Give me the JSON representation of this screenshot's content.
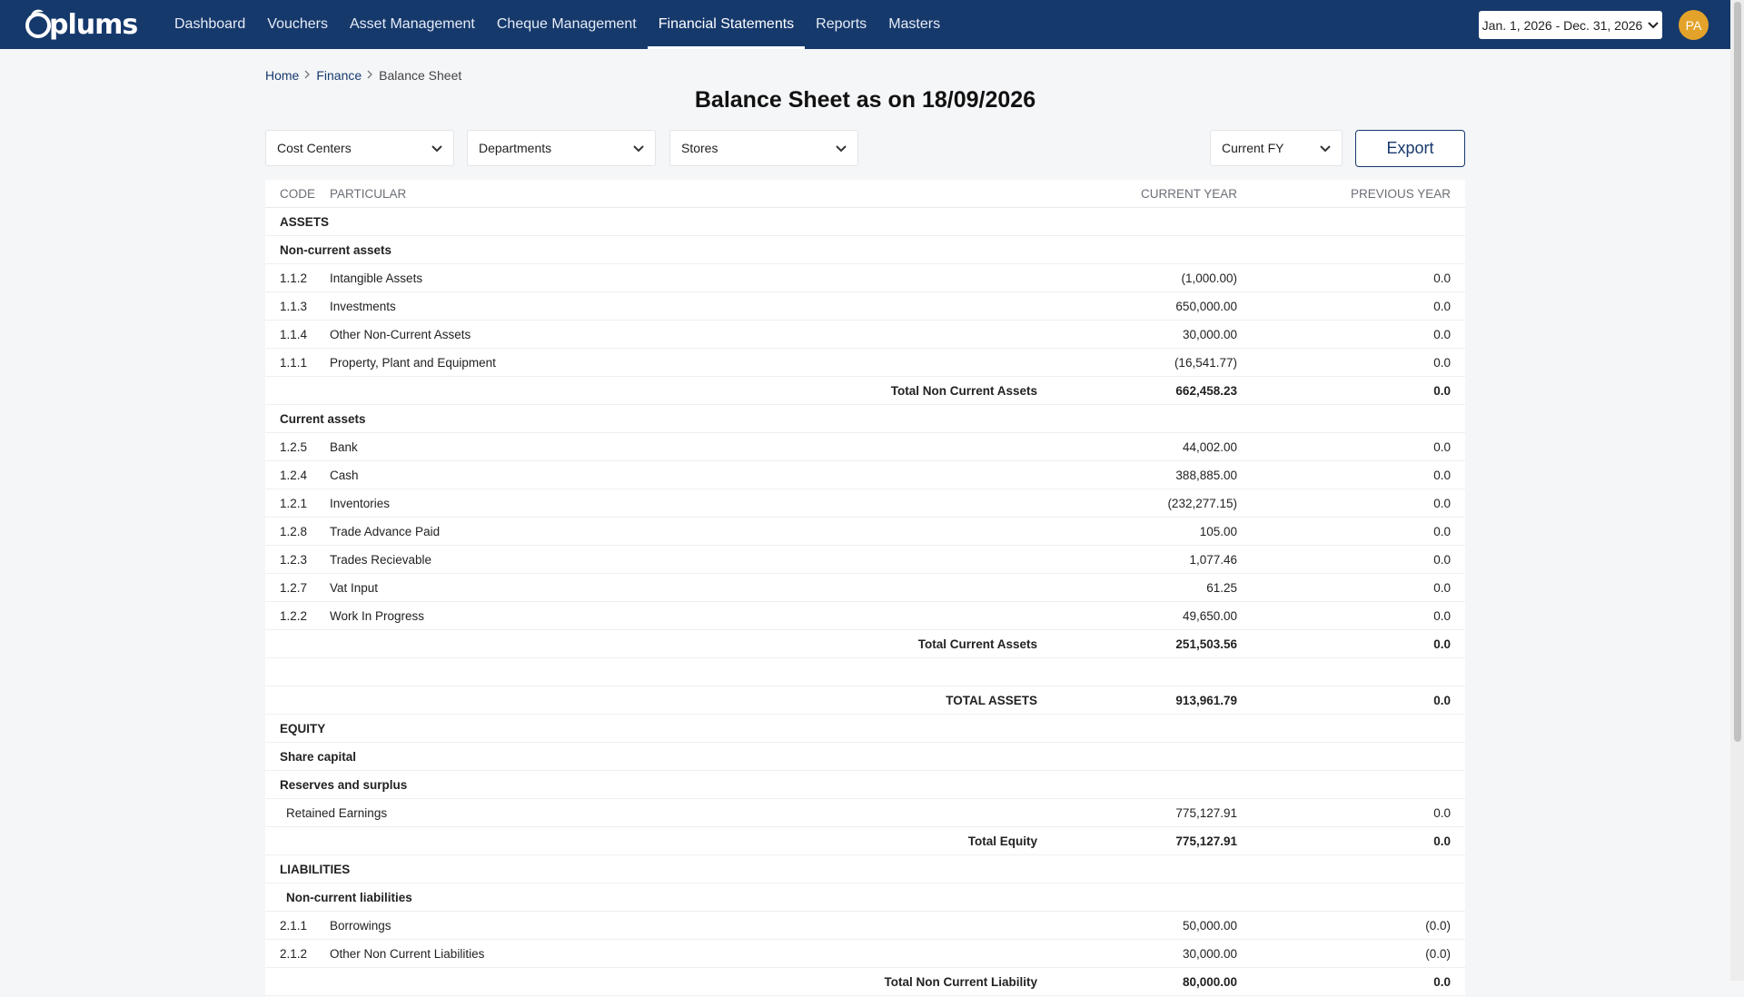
{
  "app": {
    "logo_text": "plums",
    "nav": [
      {
        "label": "Dashboard"
      },
      {
        "label": "Vouchers"
      },
      {
        "label": "Asset Management"
      },
      {
        "label": "Cheque Management"
      },
      {
        "label": "Financial Statements",
        "active": true
      },
      {
        "label": "Reports"
      },
      {
        "label": "Masters"
      }
    ],
    "date_range": "Jan. 1, 2026 - Dec. 31, 2026",
    "avatar_initials": "PA"
  },
  "breadcrumb": {
    "home": "Home",
    "finance": "Finance",
    "current": "Balance Sheet"
  },
  "page_title": "Balance Sheet as on 18/09/2026",
  "filters": {
    "cost_centers": "Cost Centers",
    "departments": "Departments",
    "stores": "Stores",
    "fiscal_year": "Current FY",
    "export_label": "Export"
  },
  "table": {
    "headers": {
      "code": "CODE",
      "particular": "PARTICULAR",
      "current": "CURRENT YEAR",
      "previous": "PREVIOUS YEAR"
    },
    "rows": [
      {
        "kind": "section",
        "label": "ASSETS"
      },
      {
        "kind": "group",
        "label": "Non-current assets"
      },
      {
        "kind": "item",
        "code": "1.1.2",
        "label": "Intangible Assets",
        "current": "(1,000.00)",
        "previous": "0.0"
      },
      {
        "kind": "item",
        "code": "1.1.3",
        "label": "Investments",
        "current": "650,000.00",
        "previous": "0.0"
      },
      {
        "kind": "item",
        "code": "1.1.4",
        "label": "Other Non-Current Assets",
        "current": "30,000.00",
        "previous": "0.0"
      },
      {
        "kind": "item",
        "code": "1.1.1",
        "label": "Property, Plant and Equipment",
        "current": "(16,541.77)",
        "previous": "0.0"
      },
      {
        "kind": "total",
        "label": "Total Non Current Assets",
        "current": "662,458.23",
        "previous": "0.0"
      },
      {
        "kind": "group",
        "label": "Current assets"
      },
      {
        "kind": "item",
        "code": "1.2.5",
        "label": "Bank",
        "current": "44,002.00",
        "previous": "0.0"
      },
      {
        "kind": "item",
        "code": "1.2.4",
        "label": "Cash",
        "current": "388,885.00",
        "previous": "0.0"
      },
      {
        "kind": "item",
        "code": "1.2.1",
        "label": "Inventories",
        "current": "(232,277.15)",
        "previous": "0.0"
      },
      {
        "kind": "item",
        "code": "1.2.8",
        "label": "Trade Advance Paid",
        "current": "105.00",
        "previous": "0.0"
      },
      {
        "kind": "item",
        "code": "1.2.3",
        "label": "Trades Recievable",
        "current": "1,077.46",
        "previous": "0.0"
      },
      {
        "kind": "item",
        "code": "1.2.7",
        "label": "Vat Input",
        "current": "61.25",
        "previous": "0.0"
      },
      {
        "kind": "item",
        "code": "1.2.2",
        "label": "Work In Progress",
        "current": "49,650.00",
        "previous": "0.0"
      },
      {
        "kind": "total",
        "label": "Total Current Assets",
        "current": "251,503.56",
        "previous": "0.0"
      },
      {
        "kind": "blank"
      },
      {
        "kind": "total",
        "label": "TOTAL ASSETS",
        "current": "913,961.79",
        "previous": "0.0"
      },
      {
        "kind": "section",
        "label": "EQUITY"
      },
      {
        "kind": "group",
        "label": "Share capital"
      },
      {
        "kind": "group",
        "label": "Reserves and surplus"
      },
      {
        "kind": "subitem",
        "label": "Retained Earnings",
        "current": "775,127.91",
        "previous": "0.0"
      },
      {
        "kind": "total",
        "label": "Total Equity",
        "current": "775,127.91",
        "previous": "0.0"
      },
      {
        "kind": "section",
        "label": "LIABILITIES"
      },
      {
        "kind": "subgroup",
        "label": "Non-current liabilities"
      },
      {
        "kind": "item",
        "code": "2.1.1",
        "label": "Borrowings",
        "current": "50,000.00",
        "previous": "(0.0)"
      },
      {
        "kind": "item",
        "code": "2.1.2",
        "label": "Other Non Current Liabilities",
        "current": "30,000.00",
        "previous": "(0.0)"
      },
      {
        "kind": "total",
        "label": "Total Non Current Liability",
        "current": "80,000.00",
        "previous": "0.0"
      }
    ]
  }
}
